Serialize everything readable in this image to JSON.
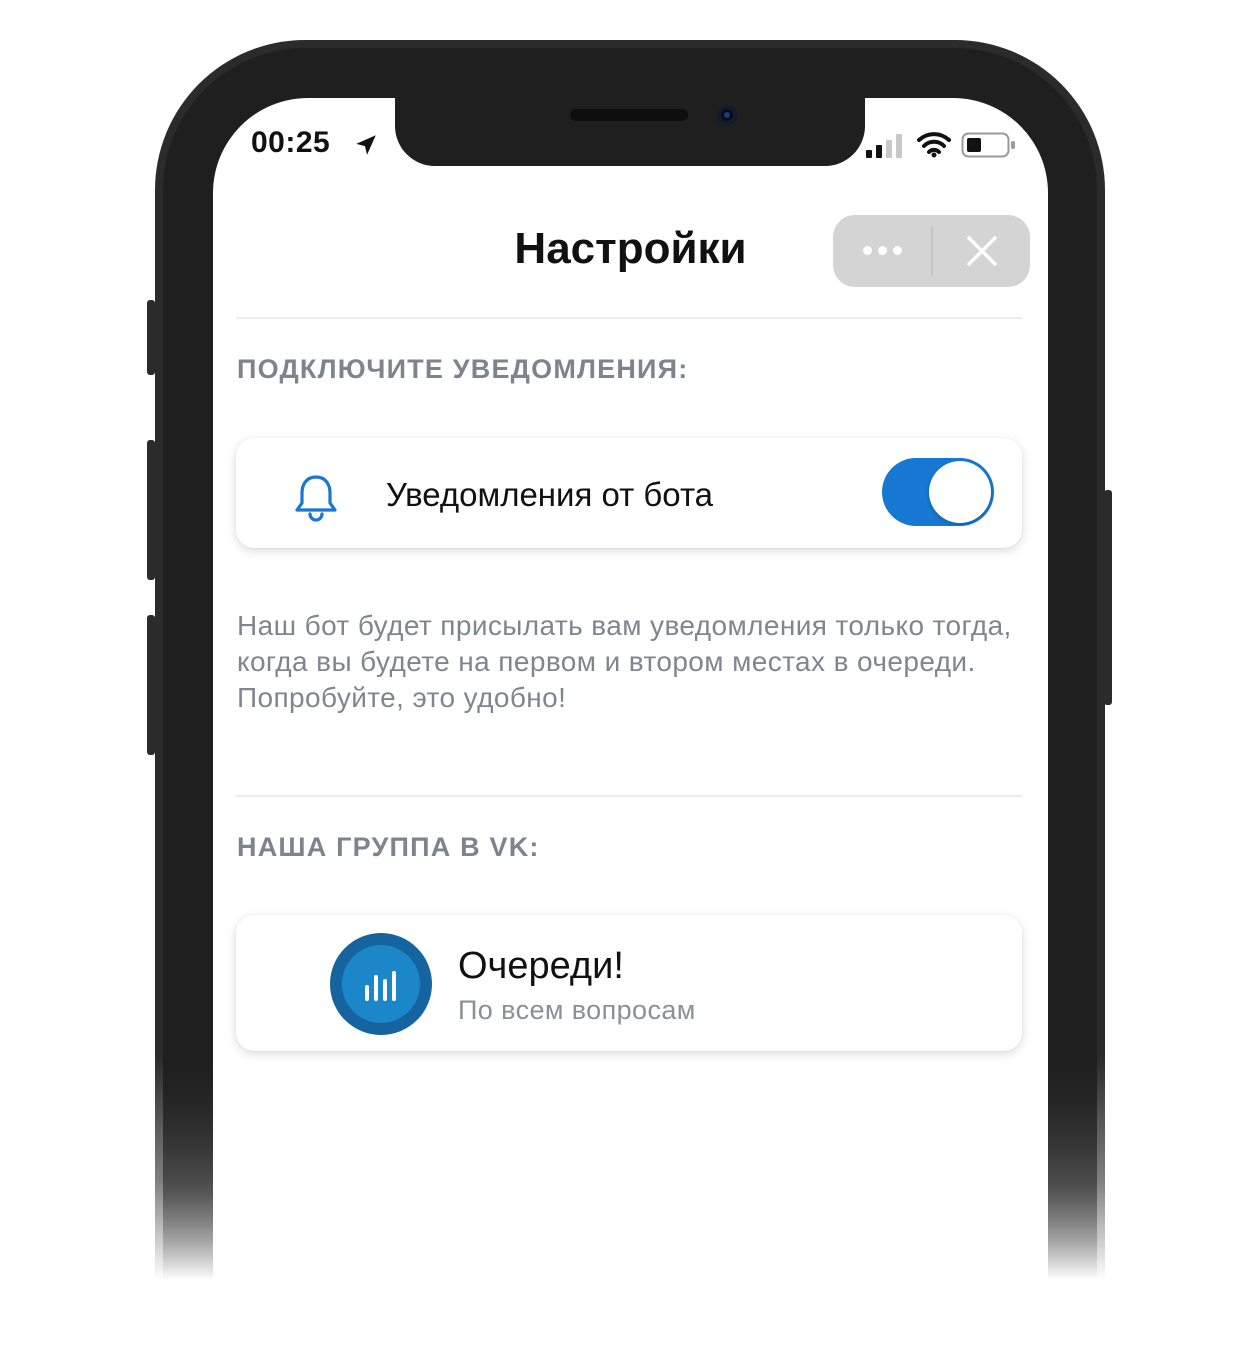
{
  "status_bar": {
    "time": "00:25",
    "location_icon": "location-arrow-icon",
    "signal_icon": "cellular-signal-icon",
    "wifi_icon": "wifi-icon",
    "battery_icon": "battery-icon"
  },
  "header": {
    "title": "Настройки",
    "more_icon": "more-horizontal-icon",
    "close_icon": "close-icon"
  },
  "notifications_section": {
    "title": "ПОДКЛЮЧИТЕ УВЕДОМЛЕНИЯ:",
    "toggle_label": "Уведомления от бота",
    "toggle_on": true,
    "icon": "bell-icon",
    "hint": "Наш бот будет присылать вам уведомления только тогда, когда вы будете на первом и втором местах в очереди. Попробуйте, это удобно!"
  },
  "group_section": {
    "title": "НАША ГРУППА В VK:",
    "group_name": "Очереди!",
    "group_subtitle": "По всем вопросам",
    "avatar_icon": "bar-chart-icon"
  },
  "colors": {
    "accent": "#1678d2",
    "avatar_dark": "#15639f",
    "avatar_light": "#1b86c8",
    "section_gray": "#7d848e",
    "pill_gray": "#d4d4d4"
  }
}
